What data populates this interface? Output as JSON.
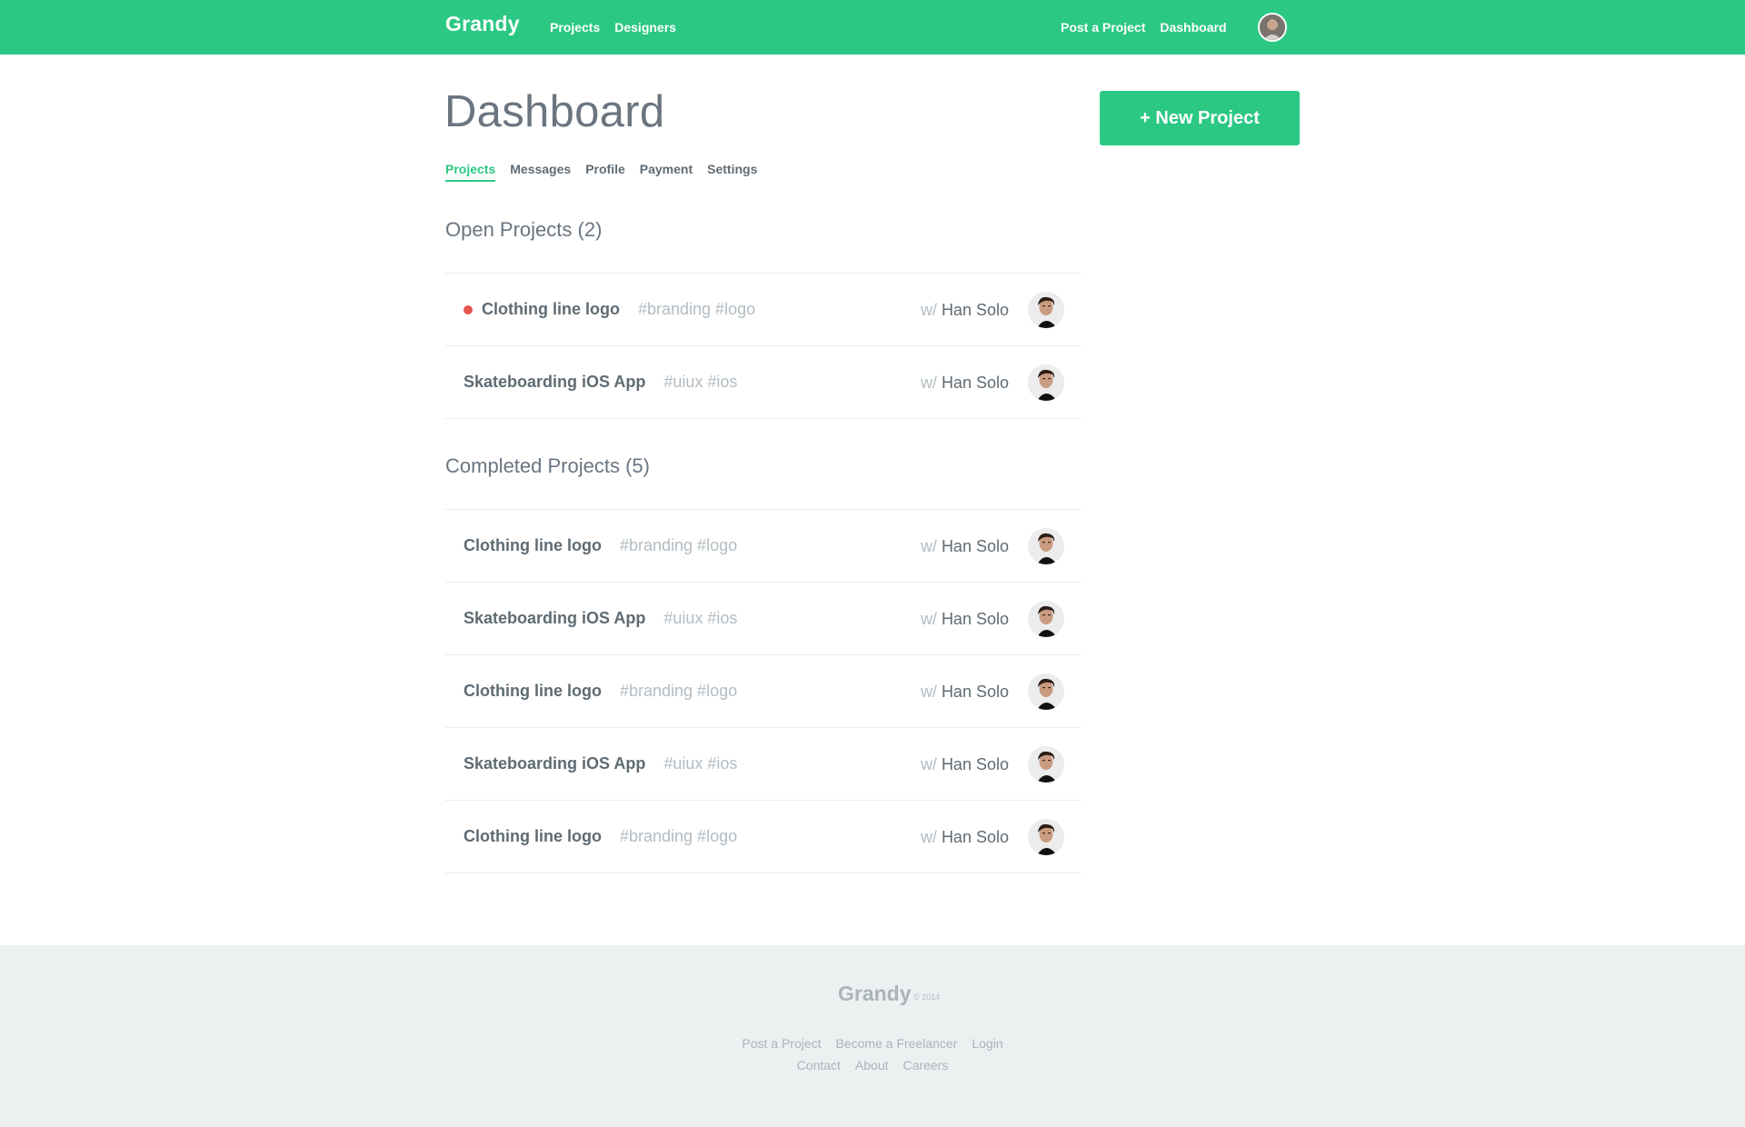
{
  "nav": {
    "brand": "Grandy",
    "left_links": [
      "Projects",
      "Designers"
    ],
    "right_links": [
      "Post a Project",
      "Dashboard"
    ],
    "avatar_icon": "user-avatar"
  },
  "header": {
    "title": "Dashboard",
    "new_project_label": "+ New Project"
  },
  "tabs": [
    {
      "label": "Projects",
      "active": true
    },
    {
      "label": "Messages",
      "active": false
    },
    {
      "label": "Profile",
      "active": false
    },
    {
      "label": "Payment",
      "active": false
    },
    {
      "label": "Settings",
      "active": false
    }
  ],
  "open_projects": {
    "title": "Open Projects (2)",
    "items": [
      {
        "name": "Clothing line logo",
        "tags": "#branding #logo",
        "with_prefix": "w/",
        "with_name": "Han Solo",
        "unread": true
      },
      {
        "name": "Skateboarding iOS App",
        "tags": "#uiux #ios",
        "with_prefix": "w/",
        "with_name": "Han Solo",
        "unread": false
      }
    ]
  },
  "completed_projects": {
    "title": "Completed Projects (5)",
    "items": [
      {
        "name": "Clothing line logo",
        "tags": "#branding #logo",
        "with_prefix": "w/",
        "with_name": "Han Solo",
        "unread": false
      },
      {
        "name": "Skateboarding iOS App",
        "tags": "#uiux #ios",
        "with_prefix": "w/",
        "with_name": "Han Solo",
        "unread": false
      },
      {
        "name": "Clothing line logo",
        "tags": "#branding #logo",
        "with_prefix": "w/",
        "with_name": "Han Solo",
        "unread": false
      },
      {
        "name": "Skateboarding iOS App",
        "tags": "#uiux #ios",
        "with_prefix": "w/",
        "with_name": "Han Solo",
        "unread": false
      },
      {
        "name": "Clothing line logo",
        "tags": "#branding #logo",
        "with_prefix": "w/",
        "with_name": "Han Solo",
        "unread": false
      }
    ]
  },
  "footer": {
    "brand": "Grandy",
    "copyright": "© 2014",
    "links_row1": [
      "Post a Project",
      "Become a Freelancer",
      "Login"
    ],
    "links_row2": [
      "Contact",
      "About",
      "Careers"
    ]
  },
  "colors": {
    "brand_green": "#2bc883",
    "unread_dot": "#e2574c",
    "footer_bg": "#ecf0f1"
  }
}
